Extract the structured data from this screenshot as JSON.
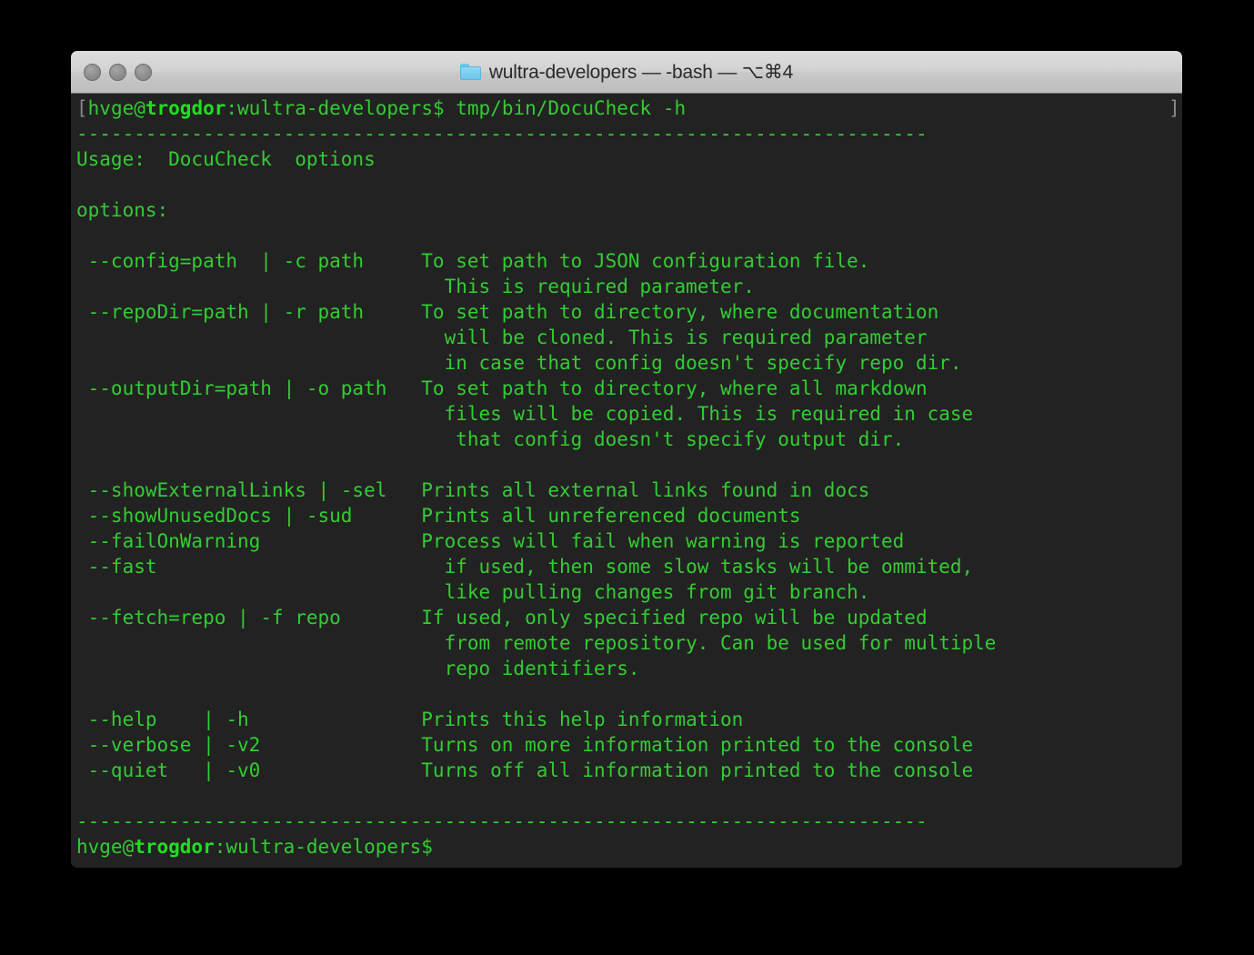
{
  "window": {
    "title": "wultra-developers — -bash — ⌥⌘4",
    "folder_icon": "folder-icon",
    "buttons": {
      "close": "close-button",
      "minimize": "minimize-button",
      "zoom": "zoom-button"
    },
    "background_color": "#222222",
    "text_color": "#33cc33",
    "bold_color": "#22dd22",
    "dim_color": "#8a8a8a"
  },
  "terminal": {
    "prompt_user": "hvge@",
    "prompt_host": "trogdor",
    "prompt_path": ":wultra-developers$ ",
    "command": "tmp/bin/DocuCheck -h",
    "open_bracket": "[",
    "close_bracket": "]",
    "divider": "--------------------------------------------------------------------------",
    "usage_line": "Usage:  DocuCheck  options",
    "options_header": "options:",
    "final_prompt_user": "hvge@",
    "final_prompt_host": "trogdor",
    "final_prompt_path": ":wultra-developers$",
    "option_lines": [
      " --config=path  | -c path     To set path to JSON configuration file.",
      "                                This is required parameter.",
      " --repoDir=path | -r path     To set path to directory, where documentation",
      "                                will be cloned. This is required parameter",
      "                                in case that config doesn't specify repo dir.",
      " --outputDir=path | -o path   To set path to directory, where all markdown",
      "                                files will be copied. This is required in case",
      "                                 that config doesn't specify output dir.",
      "",
      " --showExternalLinks | -sel   Prints all external links found in docs",
      " --showUnusedDocs | -sud      Prints all unreferenced documents",
      " --failOnWarning              Process will fail when warning is reported",
      " --fast                         if used, then some slow tasks will be ommited,",
      "                                like pulling changes from git branch.",
      " --fetch=repo | -f repo       If used, only specified repo will be updated",
      "                                from remote repository. Can be used for multiple",
      "                                repo identifiers.",
      "",
      " --help    | -h               Prints this help information",
      " --verbose | -v2              Turns on more information printed to the console",
      " --quiet   | -v0              Turns off all information printed to the console"
    ]
  }
}
